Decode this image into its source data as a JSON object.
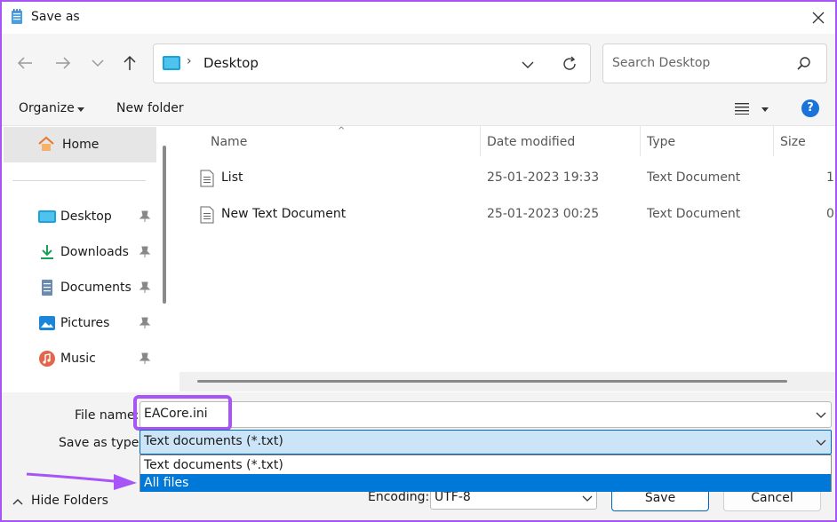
{
  "window": {
    "title": "Save as"
  },
  "nav": {
    "address_path": "Desktop",
    "address_separator": "›",
    "search_placeholder": "Search Desktop"
  },
  "toolbar": {
    "organize_label": "Organize",
    "new_folder_label": "New folder",
    "help_label": "?"
  },
  "sidebar": {
    "home_label": "Home",
    "items": [
      {
        "label": "Desktop",
        "icon": "desktop-icon",
        "pinned": true
      },
      {
        "label": "Downloads",
        "icon": "downloads-icon",
        "pinned": true
      },
      {
        "label": "Documents",
        "icon": "documents-icon",
        "pinned": true
      },
      {
        "label": "Pictures",
        "icon": "pictures-icon",
        "pinned": true
      },
      {
        "label": "Music",
        "icon": "music-icon",
        "pinned": true
      }
    ]
  },
  "file_list": {
    "columns": [
      "Name",
      "Date modified",
      "Type",
      "Size"
    ],
    "rows": [
      {
        "name": "List",
        "date": "25-01-2023 19:33",
        "type": "Text Document",
        "size": "1"
      },
      {
        "name": "New Text Document",
        "date": "25-01-2023 00:25",
        "type": "Text Document",
        "size": "0"
      }
    ]
  },
  "form": {
    "file_name_label": "File name:",
    "file_name_value": "EACore.ini",
    "save_type_label": "Save as type:",
    "save_type_value": "Text documents (*.txt)",
    "save_type_options": [
      "Text documents (*.txt)",
      "All files"
    ],
    "save_type_highlighted": "All files",
    "encoding_label": "Encoding:",
    "encoding_value": "UTF-8",
    "save_label": "Save",
    "cancel_label": "Cancel",
    "hide_folders_label": "Hide Folders"
  },
  "colors": {
    "annotation": "#a855f7",
    "selection": "#0078d7",
    "type_field_bg": "#cce4f7",
    "help_icon": "#1a73d9"
  }
}
